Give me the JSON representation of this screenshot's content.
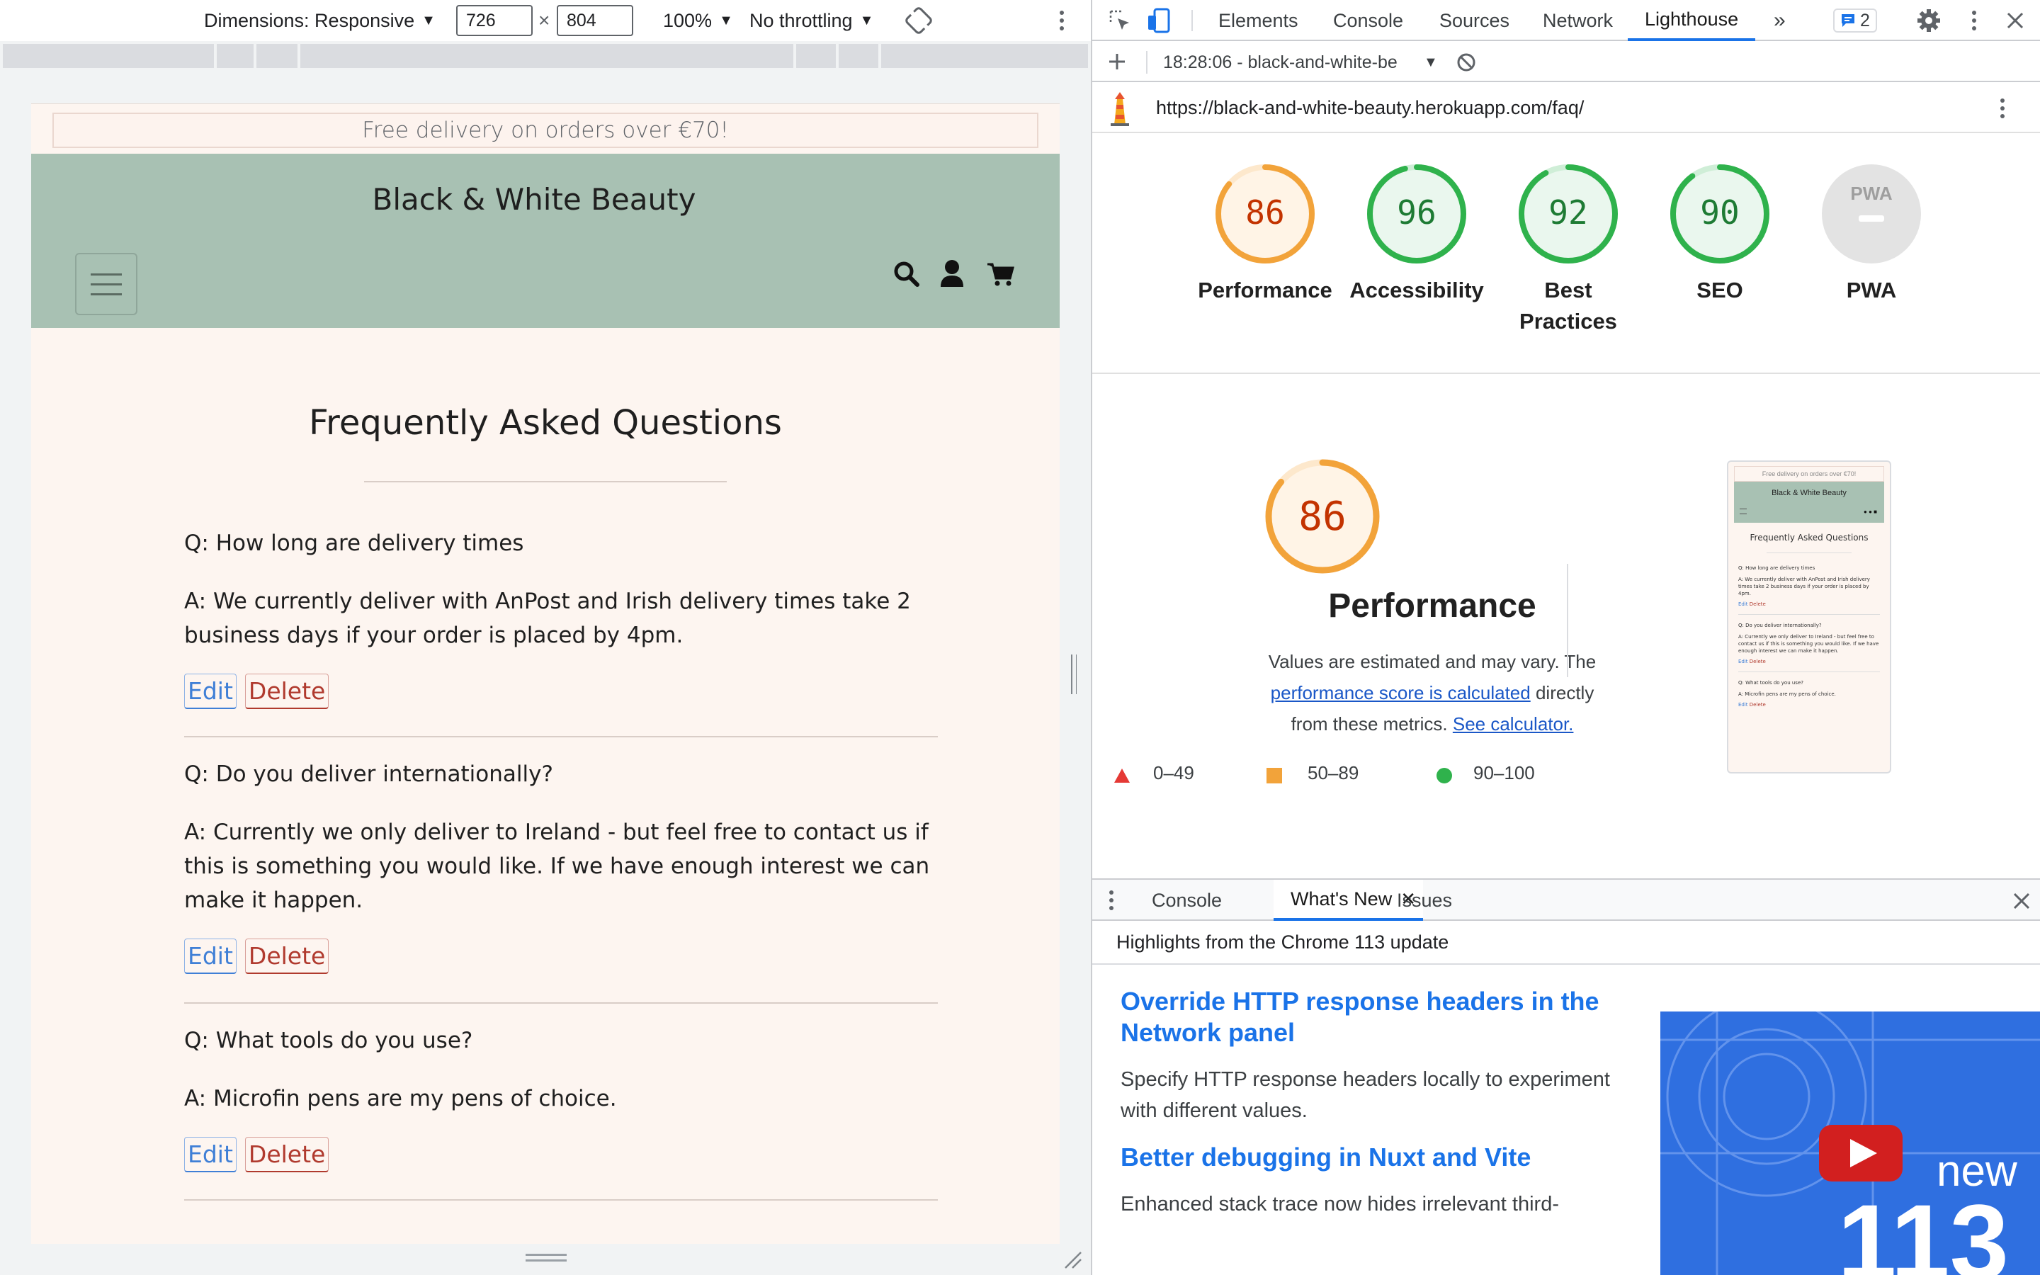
{
  "device_toolbar": {
    "dimensions_label": "Dimensions: Responsive",
    "width_value": "726",
    "times_symbol": "×",
    "height_value": "804",
    "zoom_label": "100%",
    "throttle_label": "No throttling",
    "rotate_icon": "rotate-icon",
    "more_icon": "more-vertical-icon"
  },
  "site": {
    "banner_text": "Free delivery on orders over €70!",
    "brand": "Black & White Beauty",
    "header_bg": "#a8c1b3",
    "page_bg": "#fdf5f0",
    "page_title": "Frequently Asked Questions",
    "edit_label": "Edit",
    "delete_label": "Delete",
    "faqs": [
      {
        "q": "Q: How long are delivery times",
        "a": "A: We currently deliver with AnPost and Irish delivery times take 2 business days if your order is placed by 4pm."
      },
      {
        "q": "Q: Do you deliver internationally?",
        "a": "A: Currently we only deliver to Ireland - but feel free to contact us if this is something you would like. If we have enough interest we can make it happen."
      },
      {
        "q": "Q: What tools do you use?",
        "a": "A: Microfin pens are my pens of choice."
      }
    ]
  },
  "devtools": {
    "tabs": [
      "Elements",
      "Console",
      "Sources",
      "Network",
      "Lighthouse"
    ],
    "active_tab": "Lighthouse",
    "issues_count": "2",
    "accent": "#1a73e8",
    "report_selector": "18:28:06 - black-and-white-be",
    "url": "https://black-and-white-beauty.herokuapp.com/faq/",
    "gauges": [
      {
        "score": "86",
        "label": "Performance"
      },
      {
        "score": "96",
        "label": "Accessibility"
      },
      {
        "score": "92",
        "label": "Best Practices"
      },
      {
        "score": "90",
        "label": "SEO"
      },
      {
        "score": "",
        "label": "PWA",
        "badge": "PWA"
      }
    ],
    "perf_score": "86",
    "perf_title": "Performance",
    "perf_note_prefix": "Values are estimated and may vary. The ",
    "perf_note_link1": "performance score is calculated",
    "perf_note_mid": " directly from these metrics. ",
    "perf_note_link2": "See calculator.",
    "legend": [
      {
        "range": "0–49",
        "shape": "triangle",
        "color": "#e53935"
      },
      {
        "range": "50–89",
        "shape": "square",
        "color": "#f2a33a"
      },
      {
        "range": "90–100",
        "shape": "circle",
        "color": "#2fb24c"
      }
    ],
    "thumbnail": {
      "banner": "Free delivery on orders over €70!",
      "brand": "Black & White Beauty",
      "title": "Frequently Asked Questions",
      "q1": "Q: How long are delivery times",
      "a1": "A: We currently deliver with AnPost and Irish delivery times take 2 business days if your order is placed by 4pm.",
      "q2": "Q: Do you deliver internationally?",
      "a2": "A: Currently we only deliver to Ireland - but feel free to contact us if this is something you would like. If we have enough interest we can make it happen.",
      "q3": "Q: What tools do you use?",
      "a3": "A: Microfin pens are my pens of choice.",
      "edit": "Edit",
      "delete": "Delete"
    },
    "drawer": {
      "tabs": [
        "Console",
        "What's New",
        "Issues"
      ],
      "active_tab": "What's New",
      "highlights": "Highlights from the Chrome 113 update",
      "items": [
        {
          "title": "Override HTTP response headers in the Network panel",
          "desc": "Specify HTTP response headers locally to experiment with different values."
        },
        {
          "title": "Better debugging in Nuxt and Vite",
          "desc": "Enhanced stack trace now hides irrelevant third-"
        }
      ],
      "banner_new": "new",
      "banner_number": "113"
    }
  }
}
